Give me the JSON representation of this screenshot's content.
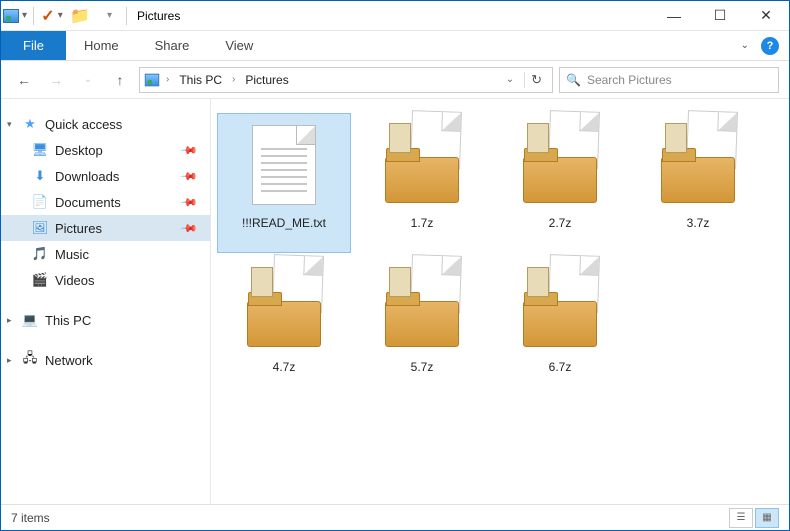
{
  "window": {
    "title": "Pictures"
  },
  "ribbon": {
    "file": "File",
    "tabs": [
      "Home",
      "Share",
      "View"
    ]
  },
  "breadcrumb": {
    "items": [
      "This PC",
      "Pictures"
    ]
  },
  "search": {
    "placeholder": "Search Pictures"
  },
  "sidebar": {
    "quick_access": {
      "label": "Quick access",
      "items": [
        {
          "label": "Desktop",
          "icon": "desktop",
          "pinned": true
        },
        {
          "label": "Downloads",
          "icon": "downloads",
          "pinned": true
        },
        {
          "label": "Documents",
          "icon": "documents",
          "pinned": true
        },
        {
          "label": "Pictures",
          "icon": "pictures",
          "pinned": true,
          "selected": true
        },
        {
          "label": "Music",
          "icon": "music",
          "pinned": false
        },
        {
          "label": "Videos",
          "icon": "videos",
          "pinned": false
        }
      ]
    },
    "this_pc": {
      "label": "This PC"
    },
    "network": {
      "label": "Network"
    }
  },
  "files": [
    {
      "name": "!!!READ_ME.txt",
      "type": "txt",
      "selected": true
    },
    {
      "name": "1.7z",
      "type": "7z"
    },
    {
      "name": "2.7z",
      "type": "7z"
    },
    {
      "name": "3.7z",
      "type": "7z"
    },
    {
      "name": "4.7z",
      "type": "7z"
    },
    {
      "name": "5.7z",
      "type": "7z"
    },
    {
      "name": "6.7z",
      "type": "7z"
    }
  ],
  "status": {
    "count_label": "7 items"
  }
}
